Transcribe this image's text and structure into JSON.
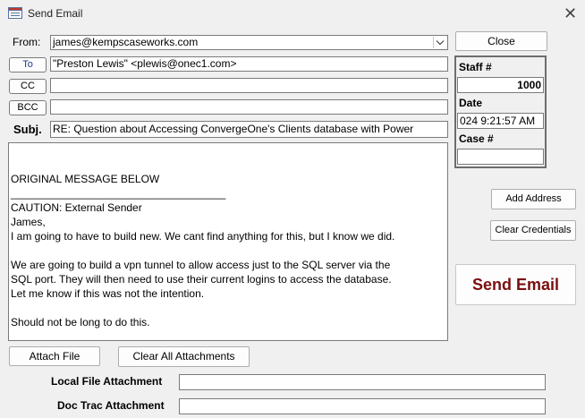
{
  "window": {
    "title": "Send Email",
    "app_icon": "form-icon",
    "close_icon": "close-icon"
  },
  "from": {
    "label": "From:",
    "value": "james@kempscaseworks.com"
  },
  "to": {
    "button_label": "To",
    "value": "\"Preston Lewis\" <plewis@onec1.com>"
  },
  "cc": {
    "button_label": "CC",
    "value": ""
  },
  "bcc": {
    "button_label": "BCC",
    "value": ""
  },
  "subject": {
    "label": "Subj.",
    "value": "RE: Question about Accessing ConvergeOne's Clients database with Power"
  },
  "body_lines": [
    "",
    "",
    "ORIGINAL MESSAGE BELOW",
    "____________________________________",
    "CAUTION: External Sender",
    "James,",
    "I am going to have to build new. We cant find anything for this, but I know we did.",
    "",
    "We are going to build a vpn tunnel to allow access just to the SQL server via the",
    "SQL port. They will then need to use their current logins to access the database.",
    "Let me know if this was not the intention.",
    "",
    "Should not be long to do this."
  ],
  "sidebar": {
    "close_label": "Close",
    "staff_label": "Staff #",
    "staff_value": "1000",
    "date_label": "Date",
    "date_value": "024 9:21:57 AM",
    "case_label": "Case #",
    "case_value": "",
    "add_address_label": "Add Address",
    "clear_credentials_label": "Clear Credentials",
    "send_email_label": "Send Email"
  },
  "attachments": {
    "attach_file_label": "Attach File",
    "clear_all_label": "Clear All Attachments",
    "local_file_label": "Local File Attachment",
    "local_file_value": "",
    "doc_trac_label": "Doc Trac Attachment",
    "doc_trac_value": ""
  },
  "colors": {
    "send_email_text": "#7a0f0f",
    "background": "#f0f0f0"
  }
}
